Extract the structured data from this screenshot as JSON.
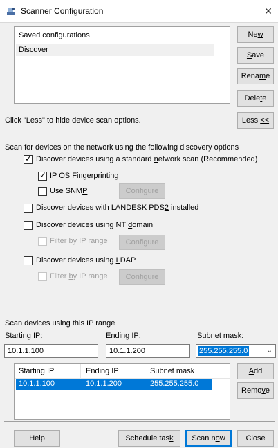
{
  "window": {
    "title": "Scanner Configuration",
    "close_glyph": "✕"
  },
  "saved": {
    "items": [
      "Saved configurations",
      "Discover"
    ],
    "new_label": "New",
    "save_label": "Save",
    "rename_label": "Rename",
    "delete_label": "Delete"
  },
  "hint": {
    "text": "Click \"Less\" to hide device scan options.",
    "less_label": "Less <<"
  },
  "options": {
    "intro": "Scan for devices on the network using the following discovery options",
    "standard_scan": {
      "label": "Discover devices using a standard network scan (Recommended)",
      "checked": true
    },
    "os_fingerprinting": {
      "label": "IP OS Fingerprinting",
      "checked": true
    },
    "snmp": {
      "label": "Use SNMP",
      "checked": false,
      "configure_label": "Configure"
    },
    "pds2": {
      "label": "Discover devices with LANDESK PDS2 installed",
      "checked": false
    },
    "nt_domain": {
      "label": "Discover devices using NT domain",
      "checked": false
    },
    "nt_filter": {
      "label": "Filter by IP range",
      "configure_label": "Configure"
    },
    "ldap": {
      "label": "Discover devices using LDAP",
      "checked": false
    },
    "ldap_filter": {
      "label": "Filter by IP range",
      "configure_label": "Configure"
    }
  },
  "range": {
    "heading": "Scan devices using this IP range",
    "starting_ip_label": "Starting IP:",
    "ending_ip_label": "Ending IP:",
    "subnet_label": "Subnet mask:",
    "starting_ip_value": "10.1.1.100",
    "ending_ip_value": "10.1.1.200",
    "subnet_value": "255.255.255.0",
    "columns": [
      "Starting IP",
      "Ending IP",
      "Subnet mask"
    ],
    "rows": [
      [
        "10.1.1.100",
        "10.1.1.200",
        "255.255.255.0"
      ]
    ],
    "add_label": "Add",
    "remove_label": "Remove"
  },
  "footer": {
    "help_label": "Help",
    "schedule_label": "Schedule task",
    "scan_label": "Scan now",
    "close_label": "Close"
  },
  "colors": {
    "accent": "#0078d7",
    "window_bg": "#f0f0f0"
  }
}
